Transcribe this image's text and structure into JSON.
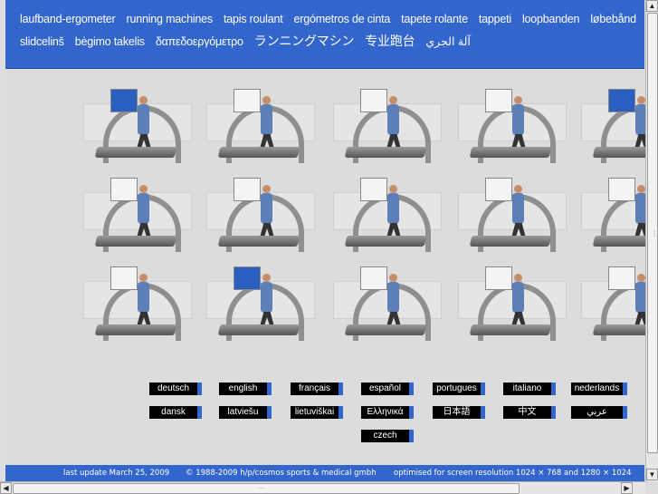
{
  "header": {
    "row1": [
      "laufband-ergometer",
      "running machines",
      "tapis roulant",
      "ergómetros de cinta",
      "tapete rolante",
      "tappeti",
      "loopbanden",
      "løbebånd"
    ],
    "row2": [
      "slidcelinš",
      "bėgimo takelis",
      "δαπεδοεργόμετρο",
      "ランニングマシン",
      "专业跑台",
      "آلة الجري"
    ]
  },
  "gallery": {
    "rows": 3,
    "columns": 5,
    "blue_screens": [
      1,
      5,
      12
    ]
  },
  "languages": {
    "row1": [
      "deutsch",
      "english",
      "français",
      "español",
      "portugues",
      "italiano",
      "nederlands"
    ],
    "row2": [
      "dansk",
      "latviešu",
      "lietuviškai",
      "Ελληνικά",
      "日本語",
      "中文",
      "عربي"
    ],
    "row3": [
      "czech"
    ]
  },
  "footer": {
    "update": "last update March 25, 2009",
    "copyright": "© 1988-2009 h/p/cosmos sports & medical gmbh",
    "resolution": "optimised for screen resolution 1024 × 768 and 1280 × 1024"
  },
  "colors": {
    "accent": "#3366cc",
    "background": "#dcdcdc",
    "button": "#000000"
  },
  "scrollbar": {
    "up_icon": "▲",
    "down_icon": "▼",
    "left_icon": "◀",
    "right_icon": "▶"
  }
}
